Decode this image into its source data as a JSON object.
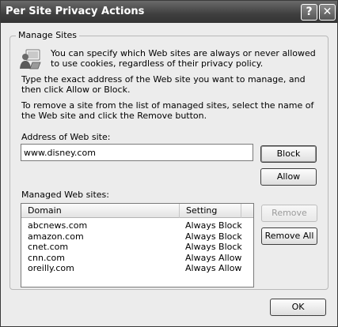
{
  "window": {
    "title": "Per Site Privacy Actions",
    "help_glyph": "?",
    "close_glyph": "✕"
  },
  "group": {
    "legend": "Manage Sites",
    "intro_text": "You can specify which Web sites are always or never allowed to use cookies, regardless of their privacy policy.",
    "type_text": "Type the exact address of the Web site you want to manage, and then click Allow or Block.",
    "remove_text": "To remove a site from the list of managed sites, select the name of the Web site and click the Remove button.",
    "address_label": "Address of Web site:",
    "address_value": "www.disney.com",
    "block_label": "Block",
    "allow_label": "Allow",
    "managed_label": "Managed Web sites:",
    "remove_label": "Remove",
    "remove_all_label": "Remove All"
  },
  "list": {
    "columns": {
      "domain": "Domain",
      "setting": "Setting"
    },
    "rows": [
      {
        "domain": "abcnews.com",
        "setting": "Always Block"
      },
      {
        "domain": "amazon.com",
        "setting": "Always Block"
      },
      {
        "domain": "cnet.com",
        "setting": "Always Block"
      },
      {
        "domain": "cnn.com",
        "setting": "Always Allow"
      },
      {
        "domain": "oreilly.com",
        "setting": "Always Allow"
      }
    ]
  },
  "footer": {
    "ok_label": "OK"
  },
  "icons": {
    "info": "privacy-sites-icon"
  },
  "colors": {
    "titlebar": "#3f3f3f",
    "window_bg": "#ececec",
    "button_border": "#3d3d3d"
  }
}
